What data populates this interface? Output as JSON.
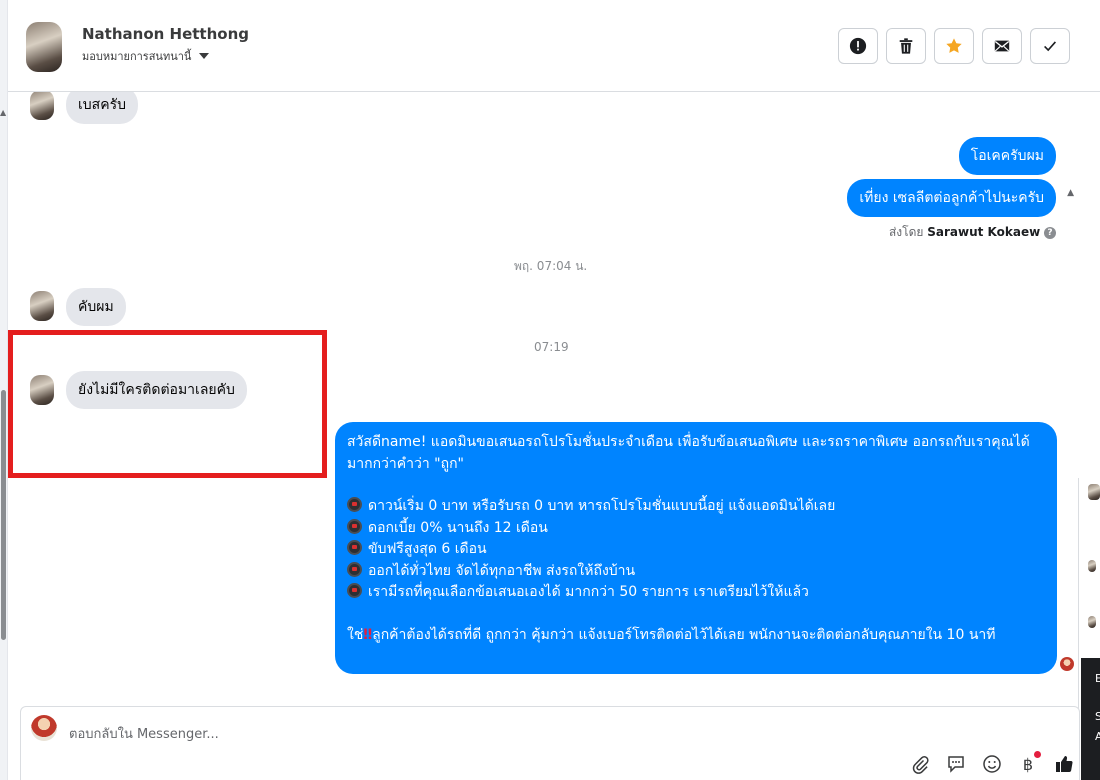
{
  "header": {
    "contact_name": "Nathanon Hetthong",
    "assign_label": "มอบหมายการสนทนานี้",
    "actions": [
      {
        "name": "spam-button",
        "icon": "alert-icon"
      },
      {
        "name": "delete-button",
        "icon": "trash-icon"
      },
      {
        "name": "star-button",
        "icon": "star-icon",
        "color": "#f5a623"
      },
      {
        "name": "mark-unread-button",
        "icon": "envelope-icon"
      },
      {
        "name": "mark-done-button",
        "icon": "check-icon"
      }
    ]
  },
  "messages": {
    "m1": "เบสครับ",
    "m2": "โอเคครับผม",
    "m3": "เที่ยง เซลลีตต่อลูกค้าไปนะครับ",
    "sent_by_label": "ส่งโดย",
    "sent_by_name": "Sarawut Kokaew",
    "ts1": "พฤ. 07:04 น.",
    "m4": "คับผม",
    "ts2": "07:19",
    "m5": "ยังไม่มีใครติดต่อมาเลยคับ",
    "promo": {
      "intro": "สวัสดีname! แอดมินขอเสนอรถโปรโมชั่นประจำเดือน เพื่อรับข้อเสนอพิเศษ และรถราคาพิเศษ ออกรถกับเราคุณได้มากกว่าคำว่า \"ถูก\"",
      "b1": "ดาวน์เริ่ม 0 บาท หรือรับรถ 0 บาท หารถโปรโมชั่นแบบนี้อยู่ แจ้งแอดมินได้เลย",
      "b2": "ดอกเบี้ย 0% นานถึง 12 เดือน",
      "b3": "ขับฟรีสูงสุด 6 เดือน",
      "b4": "ออกได้ทั่วไทย จัดได้ทุกอาชีพ ส่งรถให้ถึงบ้าน",
      "b5": "เรามีรถที่คุณเลือกข้อเสนอเองได้ มากกว่า 50 รายการ เราเตรียมไว้ให้แล้ว",
      "closing_prefix": "ใช่",
      "closing_emoji": "‼",
      "closing_rest": "ลูกค้าต้องได้รถที่ดี ถูกกว่า คุ้มกว่า แจ้งเบอร์โทรติดต่อไว้ได้เลย พนักงานจะติดต่อกลับคุณภายใน 10 นาที"
    }
  },
  "reply": {
    "placeholder": "ตอบกลับใน Messenger..."
  },
  "right_panel": {
    "letters": [
      "E",
      "S",
      "A"
    ]
  },
  "colors": {
    "outgoing_bubble": "#0084ff",
    "incoming_bubble": "#e4e6eb",
    "highlight_box": "#e41e1e"
  }
}
